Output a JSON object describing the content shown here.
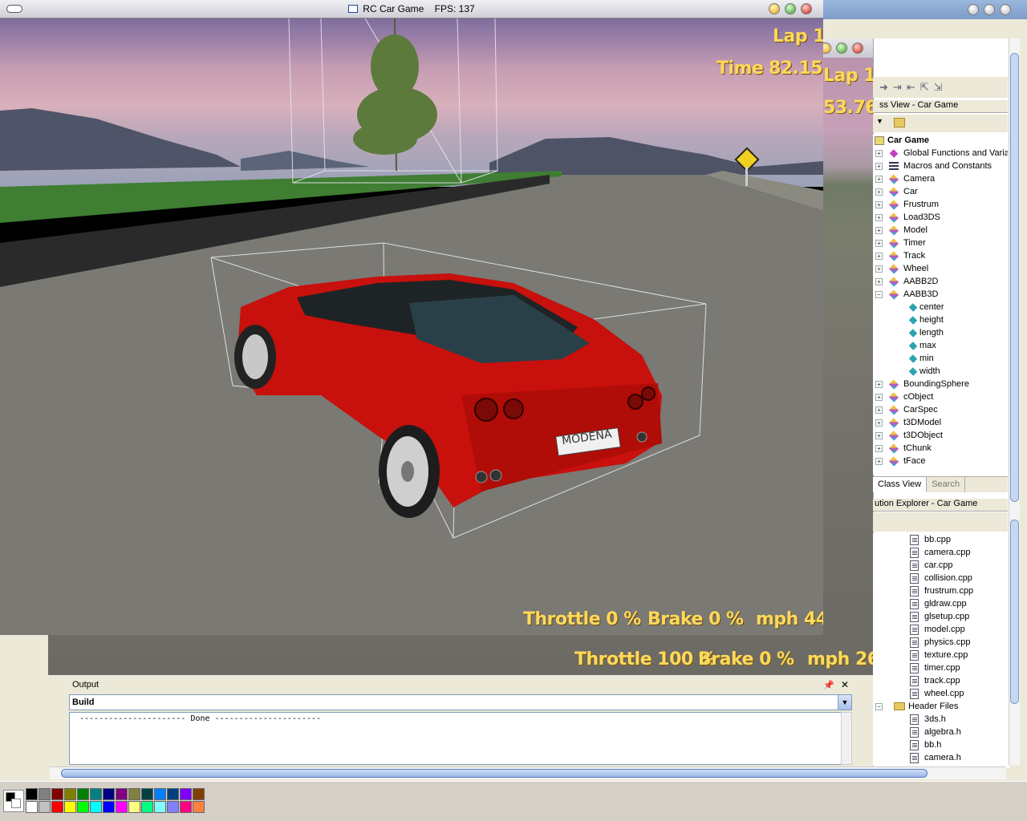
{
  "game_front": {
    "title": "RC Car Game",
    "fps_label": "FPS: 137",
    "hud": {
      "lap": "Lap 1",
      "time_label": "Time",
      "time_value": "82.15",
      "throttle": "Throttle  0 %",
      "brake": "Brake  0 %",
      "speed": "mph 44"
    },
    "plate_text": "MODENA"
  },
  "game_back": {
    "hud": {
      "lap": "Lap 1",
      "time_value": "53.76",
      "throttle": "Throttle 100 %",
      "brake": "Brake  0 %",
      "speed": "mph 26"
    }
  },
  "class_view": {
    "header": "ss View - Car Game",
    "tree": [
      {
        "label": "Car Game",
        "icon": "project-icon",
        "bold": true,
        "indent": 0,
        "expander": ""
      },
      {
        "label": "Global Functions and Variables",
        "icon": "function-icon",
        "indent": 1,
        "expander": "+"
      },
      {
        "label": "Macros and Constants",
        "icon": "macro-icon",
        "indent": 1,
        "expander": "+"
      },
      {
        "label": "Camera",
        "icon": "class-icon",
        "indent": 1,
        "expander": "+"
      },
      {
        "label": "Car",
        "icon": "class-icon",
        "indent": 1,
        "expander": "+"
      },
      {
        "label": "Frustrum",
        "icon": "class-icon",
        "indent": 1,
        "expander": "+"
      },
      {
        "label": "Load3DS",
        "icon": "class-icon",
        "indent": 1,
        "expander": "+"
      },
      {
        "label": "Model",
        "icon": "class-icon",
        "indent": 1,
        "expander": "+"
      },
      {
        "label": "Timer",
        "icon": "class-icon",
        "indent": 1,
        "expander": "+"
      },
      {
        "label": "Track",
        "icon": "class-icon",
        "indent": 1,
        "expander": "+"
      },
      {
        "label": "Wheel",
        "icon": "class-icon",
        "indent": 1,
        "expander": "+"
      },
      {
        "label": "AABB2D",
        "icon": "class-icon",
        "indent": 1,
        "expander": "+"
      },
      {
        "label": "AABB3D",
        "icon": "class-icon",
        "indent": 1,
        "expander": "−"
      },
      {
        "label": "center",
        "icon": "member-icon",
        "indent": 2,
        "expander": ""
      },
      {
        "label": "height",
        "icon": "member-icon",
        "indent": 2,
        "expander": ""
      },
      {
        "label": "length",
        "icon": "member-icon",
        "indent": 2,
        "expander": ""
      },
      {
        "label": "max",
        "icon": "member-icon",
        "indent": 2,
        "expander": ""
      },
      {
        "label": "min",
        "icon": "member-icon",
        "indent": 2,
        "expander": ""
      },
      {
        "label": "width",
        "icon": "member-icon",
        "indent": 2,
        "expander": ""
      },
      {
        "label": "BoundingSphere",
        "icon": "class-icon",
        "indent": 1,
        "expander": "+"
      },
      {
        "label": "cObject",
        "icon": "class-icon",
        "indent": 1,
        "expander": "+"
      },
      {
        "label": "CarSpec",
        "icon": "class-icon",
        "indent": 1,
        "expander": "+"
      },
      {
        "label": "t3DModel",
        "icon": "class-icon",
        "indent": 1,
        "expander": "+"
      },
      {
        "label": "t3DObject",
        "icon": "class-icon",
        "indent": 1,
        "expander": "+"
      },
      {
        "label": "tChunk",
        "icon": "class-icon",
        "indent": 1,
        "expander": "+"
      },
      {
        "label": "tFace",
        "icon": "class-icon",
        "indent": 1,
        "expander": "+"
      }
    ],
    "tabs": [
      {
        "label": "Class View",
        "active": true
      },
      {
        "label": "Search",
        "active": false
      }
    ]
  },
  "solution_explorer": {
    "header": "ution Explorer - Car Game",
    "items": [
      {
        "label": "bb.cpp",
        "type": "file",
        "indent": 2
      },
      {
        "label": "camera.cpp",
        "type": "file",
        "indent": 2
      },
      {
        "label": "car.cpp",
        "type": "file",
        "indent": 2
      },
      {
        "label": "collision.cpp",
        "type": "file",
        "indent": 2
      },
      {
        "label": "frustrum.cpp",
        "type": "file",
        "indent": 2
      },
      {
        "label": "gldraw.cpp",
        "type": "file",
        "indent": 2
      },
      {
        "label": "glsetup.cpp",
        "type": "file",
        "indent": 2
      },
      {
        "label": "model.cpp",
        "type": "file",
        "indent": 2
      },
      {
        "label": "physics.cpp",
        "type": "file",
        "indent": 2
      },
      {
        "label": "texture.cpp",
        "type": "file",
        "indent": 2
      },
      {
        "label": "timer.cpp",
        "type": "file",
        "indent": 2
      },
      {
        "label": "track.cpp",
        "type": "file",
        "indent": 2
      },
      {
        "label": "wheel.cpp",
        "type": "file",
        "indent": 2
      },
      {
        "label": "Header Files",
        "type": "folder",
        "indent": 1
      },
      {
        "label": "3ds.h",
        "type": "file",
        "indent": 2
      },
      {
        "label": "algebra.h",
        "type": "file",
        "indent": 2
      },
      {
        "label": "bb.h",
        "type": "file",
        "indent": 2
      },
      {
        "label": "camera.h",
        "type": "file",
        "indent": 2
      }
    ]
  },
  "output": {
    "title": "Output",
    "pin_icon": "pin-icon",
    "close_icon": "close-icon",
    "selected": "Build",
    "text": "---------------------- Done ----------------------"
  },
  "palette": {
    "colors": [
      "#000000",
      "#808080",
      "#800000",
      "#808000",
      "#008000",
      "#008080",
      "#000080",
      "#800080",
      "#808040",
      "#004040",
      "#0080ff",
      "#004080",
      "#8000ff",
      "#804000",
      "#ffffff",
      "#c0c0c0",
      "#ff0000",
      "#ffff00",
      "#00ff00",
      "#00ffff",
      "#0000ff",
      "#ff00ff",
      "#ffff80",
      "#00ff80",
      "#80ffff",
      "#8080ff",
      "#ff0080",
      "#ff8040"
    ]
  }
}
